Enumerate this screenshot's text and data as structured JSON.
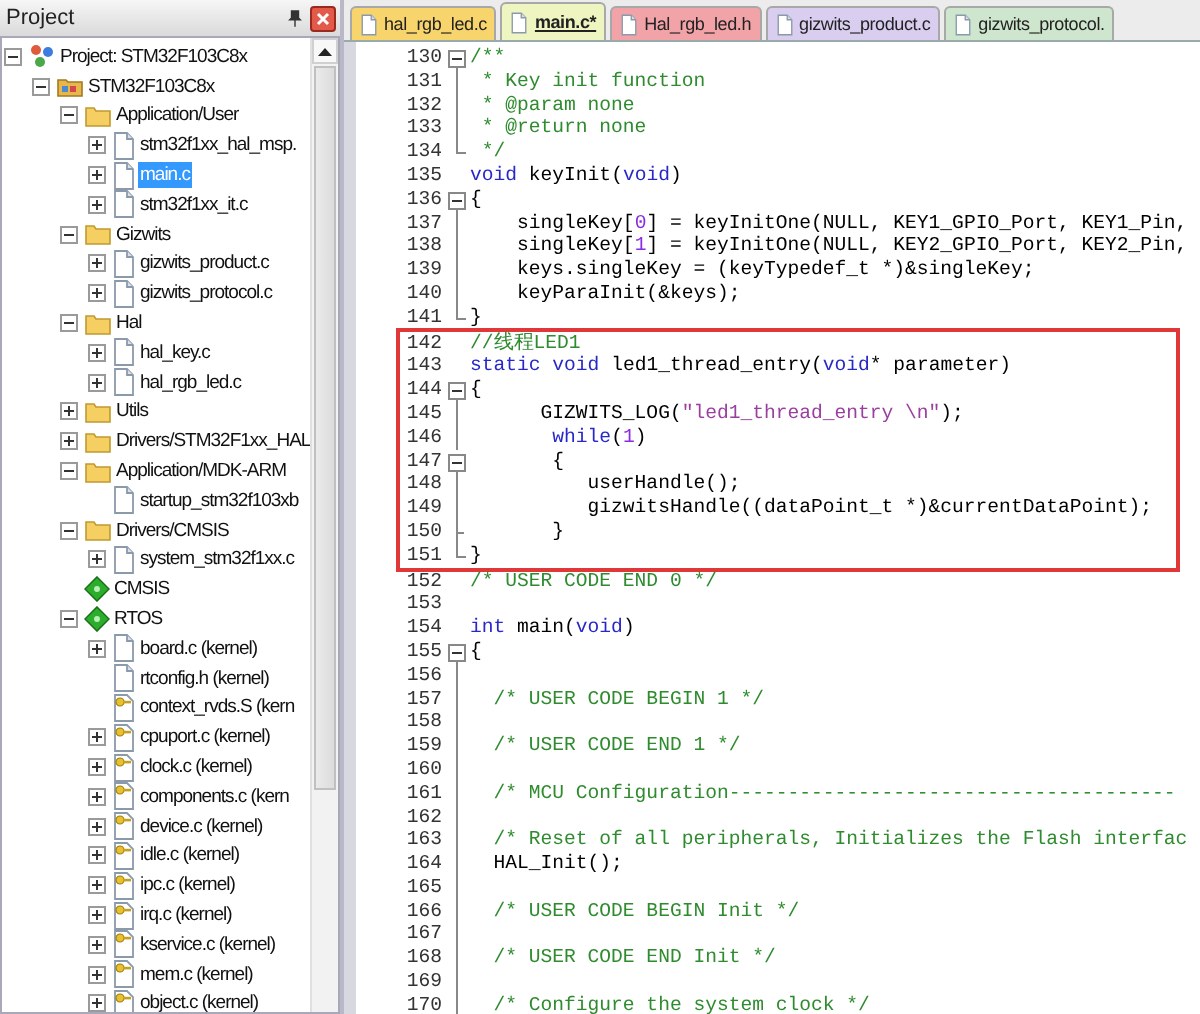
{
  "project_panel": {
    "title": "Project",
    "tree": [
      {
        "label": "Project: STM32F103C8x",
        "kind": "project",
        "expanded": true,
        "selected": false,
        "children": [
          {
            "label": "STM32F103C8x",
            "kind": "target",
            "expanded": true,
            "selected": false,
            "children": [
              {
                "label": "Application/User",
                "kind": "folder",
                "expanded": true,
                "selected": false,
                "children": [
                  {
                    "label": "stm32f1xx_hal_msp.",
                    "kind": "file",
                    "expanded": false,
                    "selected": false
                  },
                  {
                    "label": "main.c",
                    "kind": "file",
                    "expanded": false,
                    "selected": true
                  },
                  {
                    "label": "stm32f1xx_it.c",
                    "kind": "file",
                    "expanded": false,
                    "selected": false
                  }
                ]
              },
              {
                "label": "Gizwits",
                "kind": "folder",
                "expanded": true,
                "selected": false,
                "children": [
                  {
                    "label": "gizwits_product.c",
                    "kind": "file",
                    "expanded": false,
                    "selected": false
                  },
                  {
                    "label": "gizwits_protocol.c",
                    "kind": "file",
                    "expanded": false,
                    "selected": false
                  }
                ]
              },
              {
                "label": "Hal",
                "kind": "folder",
                "expanded": true,
                "selected": false,
                "children": [
                  {
                    "label": "hal_key.c",
                    "kind": "file",
                    "expanded": false,
                    "selected": false
                  },
                  {
                    "label": "hal_rgb_led.c",
                    "kind": "file",
                    "expanded": false,
                    "selected": false
                  }
                ]
              },
              {
                "label": "Utils",
                "kind": "folder",
                "expanded": false,
                "selected": false
              },
              {
                "label": "Drivers/STM32F1xx_HAL",
                "kind": "folder",
                "expanded": false,
                "selected": false
              },
              {
                "label": "Application/MDK-ARM",
                "kind": "folder",
                "expanded": true,
                "selected": false,
                "children": [
                  {
                    "label": "startup_stm32f103xb",
                    "kind": "file",
                    "selected": false
                  }
                ]
              },
              {
                "label": "Drivers/CMSIS",
                "kind": "folder",
                "expanded": true,
                "selected": false,
                "children": [
                  {
                    "label": "system_stm32f1xx.c",
                    "kind": "file",
                    "expanded": false,
                    "selected": false
                  }
                ]
              },
              {
                "label": "CMSIS",
                "kind": "component",
                "selected": false
              },
              {
                "label": "RTOS",
                "kind": "component",
                "expanded": true,
                "selected": false,
                "children": [
                  {
                    "label": "board.c (kernel)",
                    "kind": "file",
                    "expanded": false,
                    "selected": false
                  },
                  {
                    "label": "rtconfig.h (kernel)",
                    "kind": "file",
                    "selected": false
                  },
                  {
                    "label": "context_rvds.S (kern",
                    "kind": "key-file",
                    "selected": false
                  },
                  {
                    "label": "cpuport.c (kernel)",
                    "kind": "key-file",
                    "expanded": false,
                    "selected": false
                  },
                  {
                    "label": "clock.c (kernel)",
                    "kind": "key-file",
                    "expanded": false,
                    "selected": false
                  },
                  {
                    "label": "components.c (kern",
                    "kind": "key-file",
                    "expanded": false,
                    "selected": false
                  },
                  {
                    "label": "device.c (kernel)",
                    "kind": "key-file",
                    "expanded": false,
                    "selected": false
                  },
                  {
                    "label": "idle.c (kernel)",
                    "kind": "key-file",
                    "expanded": false,
                    "selected": false
                  },
                  {
                    "label": "ipc.c (kernel)",
                    "kind": "key-file",
                    "expanded": false,
                    "selected": false
                  },
                  {
                    "label": "irq.c (kernel)",
                    "kind": "key-file",
                    "expanded": false,
                    "selected": false
                  },
                  {
                    "label": "kservice.c (kernel)",
                    "kind": "key-file",
                    "expanded": false,
                    "selected": false
                  },
                  {
                    "label": "mem.c (kernel)",
                    "kind": "key-file",
                    "expanded": false,
                    "selected": false
                  },
                  {
                    "label": "object.c (kernel)",
                    "kind": "key-file",
                    "expanded": false,
                    "selected": false
                  }
                ]
              }
            ]
          }
        ]
      }
    ]
  },
  "tabs": [
    {
      "label": "hal_rgb_led.c",
      "color": "#f7d46c",
      "selected": false
    },
    {
      "label": "main.c*",
      "color": "#eef5c0",
      "selected": true
    },
    {
      "label": "Hal_rgb_led.h",
      "color": "#f2a3a8",
      "selected": false
    },
    {
      "label": "gizwits_product.c",
      "color": "#d9cdf0",
      "selected": false
    },
    {
      "label": "gizwits_protocol.",
      "color": "#cde6cd",
      "selected": false
    }
  ],
  "editor": {
    "blocks": [
      {
        "highlighted": false,
        "lines": [
          {
            "number": "130",
            "kind": "start",
            "segments": [
              {
                "kind": "comment",
                "text": "/**"
              }
            ]
          },
          {
            "number": "131",
            "kind": "line",
            "segments": [
              {
                "kind": "comment",
                "text": " * Key init function"
              }
            ]
          },
          {
            "number": "132",
            "kind": "line",
            "segments": [
              {
                "kind": "comment",
                "text": " * @param none"
              }
            ]
          },
          {
            "number": "133",
            "kind": "line",
            "segments": [
              {
                "kind": "comment",
                "text": " * @return none"
              }
            ]
          },
          {
            "number": "134",
            "kind": "end",
            "segments": [
              {
                "kind": "comment",
                "text": " */"
              }
            ]
          },
          {
            "number": "135",
            "kind": "none",
            "segments": [
              {
                "kind": "keyword",
                "text": "void"
              },
              {
                "kind": "plain",
                "text": " keyInit("
              },
              {
                "kind": "keyword",
                "text": "void"
              },
              {
                "kind": "plain",
                "text": ")"
              }
            ]
          },
          {
            "number": "136",
            "kind": "start",
            "segments": [
              {
                "kind": "plain",
                "text": "{"
              }
            ]
          },
          {
            "number": "137",
            "kind": "line",
            "segments": [
              {
                "kind": "plain",
                "text": "    singleKey["
              },
              {
                "kind": "number",
                "text": "0"
              },
              {
                "kind": "plain",
                "text": "] = keyInitOne(NULL, KEY1_GPIO_Port, KEY1_Pin,"
              }
            ]
          },
          {
            "number": "138",
            "kind": "line",
            "segments": [
              {
                "kind": "plain",
                "text": "    singleKey["
              },
              {
                "kind": "number",
                "text": "1"
              },
              {
                "kind": "plain",
                "text": "] = keyInitOne(NULL, KEY2_GPIO_Port, KEY2_Pin,"
              }
            ]
          },
          {
            "number": "139",
            "kind": "line",
            "segments": [
              {
                "kind": "plain",
                "text": "    keys.singleKey = (keyTypedef_t *)&singleKey;"
              }
            ]
          },
          {
            "number": "140",
            "kind": "line",
            "segments": [
              {
                "kind": "plain",
                "text": "    keyParaInit(&keys);"
              }
            ]
          },
          {
            "number": "141",
            "kind": "end",
            "segments": [
              {
                "kind": "plain",
                "text": "}"
              }
            ]
          }
        ]
      },
      {
        "highlighted": true,
        "lines": [
          {
            "number": "142",
            "kind": "none",
            "segments": [
              {
                "kind": "comment",
                "text": "//线程LED1"
              }
            ]
          },
          {
            "number": "143",
            "kind": "none",
            "segments": [
              {
                "kind": "keyword",
                "text": "static"
              },
              {
                "kind": "keyword",
                "text": " void"
              },
              {
                "kind": "plain",
                "text": " led1_thread_entry("
              },
              {
                "kind": "keyword",
                "text": "void"
              },
              {
                "kind": "plain",
                "text": "* parameter)"
              }
            ]
          },
          {
            "number": "144",
            "kind": "start",
            "segments": [
              {
                "kind": "plain",
                "text": "{"
              }
            ]
          },
          {
            "number": "145",
            "kind": "line",
            "segments": [
              {
                "kind": "plain",
                "text": "      GIZWITS_LOG("
              },
              {
                "kind": "string",
                "text": "\"led1_thread_entry \\n\""
              },
              {
                "kind": "plain",
                "text": ");"
              }
            ]
          },
          {
            "number": "146",
            "kind": "line",
            "segments": [
              {
                "kind": "keyword",
                "text": "       while"
              },
              {
                "kind": "plain",
                "text": "("
              },
              {
                "kind": "number",
                "text": "1"
              },
              {
                "kind": "plain",
                "text": ")"
              }
            ]
          },
          {
            "number": "147",
            "kind": "start",
            "segments": [
              {
                "kind": "plain",
                "text": "       {"
              }
            ]
          },
          {
            "number": "148",
            "kind": "line",
            "segments": [
              {
                "kind": "plain",
                "text": "          userHandle();"
              }
            ]
          },
          {
            "number": "149",
            "kind": "line",
            "segments": [
              {
                "kind": "plain",
                "text": "          gizwitsHandle((dataPoint_t *)&currentDataPoint);"
              }
            ]
          },
          {
            "number": "150",
            "kind": "branch",
            "segments": [
              {
                "kind": "plain",
                "text": "       }"
              }
            ]
          },
          {
            "number": "151",
            "kind": "end",
            "segments": [
              {
                "kind": "plain",
                "text": "}"
              }
            ]
          }
        ]
      },
      {
        "highlighted": false,
        "lines": [
          {
            "number": "152",
            "kind": "none",
            "segments": [
              {
                "kind": "comment",
                "text": "/* USER CODE END 0 */"
              }
            ]
          },
          {
            "number": "153",
            "kind": "none"
          },
          {
            "number": "154",
            "kind": "none",
            "segments": [
              {
                "kind": "keyword",
                "text": "int"
              },
              {
                "kind": "plain",
                "text": " main("
              },
              {
                "kind": "keyword",
                "text": "void"
              },
              {
                "kind": "plain",
                "text": ")"
              }
            ]
          },
          {
            "number": "155",
            "kind": "start",
            "segments": [
              {
                "kind": "plain",
                "text": "{"
              }
            ]
          },
          {
            "number": "156",
            "kind": "line"
          },
          {
            "number": "157",
            "kind": "line",
            "segments": [
              {
                "kind": "comment",
                "text": "  /* USER CODE BEGIN 1 */"
              }
            ]
          },
          {
            "number": "158",
            "kind": "line"
          },
          {
            "number": "159",
            "kind": "line",
            "segments": [
              {
                "kind": "comment",
                "text": "  /* USER CODE END 1 */"
              }
            ]
          },
          {
            "number": "160",
            "kind": "line"
          },
          {
            "number": "161",
            "kind": "line",
            "segments": [
              {
                "kind": "comment",
                "text": "  /* MCU Configuration--------------------------------------"
              }
            ]
          },
          {
            "number": "162",
            "kind": "line"
          },
          {
            "number": "163",
            "kind": "line",
            "segments": [
              {
                "kind": "comment",
                "text": "  /* Reset of all peripherals, Initializes the Flash interfac"
              }
            ]
          },
          {
            "number": "164",
            "kind": "line",
            "segments": [
              {
                "kind": "plain",
                "text": "  HAL_Init();"
              }
            ]
          },
          {
            "number": "165",
            "kind": "line"
          },
          {
            "number": "166",
            "kind": "line",
            "segments": [
              {
                "kind": "comment",
                "text": "  /* USER CODE BEGIN Init */"
              }
            ]
          },
          {
            "number": "167",
            "kind": "line"
          },
          {
            "number": "168",
            "kind": "line",
            "segments": [
              {
                "kind": "comment",
                "text": "  /* USER CODE END Init */"
              }
            ]
          },
          {
            "number": "169",
            "kind": "line"
          },
          {
            "number": "170",
            "kind": "line",
            "segments": [
              {
                "kind": "comment",
                "text": "  /* Configure the system clock */"
              }
            ]
          }
        ]
      }
    ]
  }
}
